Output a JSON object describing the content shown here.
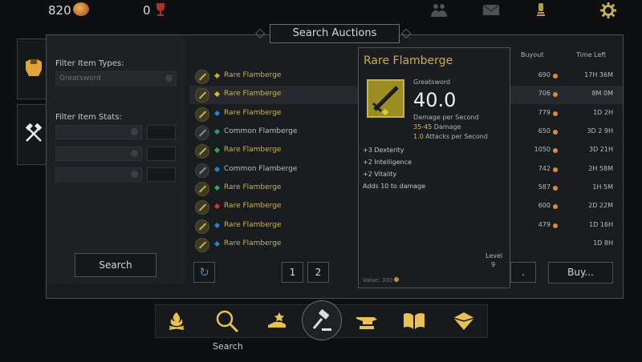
{
  "top_bar": {
    "gold": "820",
    "trophies": "0",
    "icons": [
      "coin-icon",
      "trophy-icon",
      "guild-icon",
      "mail-icon",
      "quest-icon",
      "gear-icon"
    ]
  },
  "side_tabs": [
    "armor-icon",
    "crafting-hammer-icon"
  ],
  "title": "Search Auctions",
  "filters": {
    "item_types_label": "Filter Item Types:",
    "item_type_value": "Greatsword",
    "item_stats_label": "Filter Item Stats:",
    "search_button": "Search"
  },
  "columns": {
    "buyout": "Buyout",
    "time_left": "Time Left"
  },
  "listings": [
    {
      "name": "Rare Flamberge",
      "buyout": "690",
      "time_left": "17H 36M",
      "gem": "#d4a42c",
      "rarity_color": "#c9b15a"
    },
    {
      "name": "Rare Flamberge",
      "buyout": "706",
      "time_left": "8M 0M",
      "gem": "#d4c02c",
      "rarity_color": "#c9b15a"
    },
    {
      "name": "Rare Flamberge",
      "buyout": "779",
      "time_left": "1D 2H",
      "gem": "#2d7fd0",
      "rarity_color": "#c9b15a"
    },
    {
      "name": "Common Flamberge",
      "buyout": "650",
      "time_left": "3D 2 9H",
      "gem": "#2c9a6a",
      "rarity_color": "#b9bcc0"
    },
    {
      "name": "Rare Flamberge",
      "buyout": "1050",
      "time_left": "3D 21H",
      "gem": "#3aa34d",
      "rarity_color": "#c9b15a"
    },
    {
      "name": "Common Flamberge",
      "buyout": "742",
      "time_left": "2H 58M",
      "gem": "#2d7fd0",
      "rarity_color": "#b9bcc0"
    },
    {
      "name": "Rare Flamberge",
      "buyout": "587",
      "time_left": "1H 5M",
      "gem": "#3aa34d",
      "rarity_color": "#c9b15a"
    },
    {
      "name": "Rare Flamberge",
      "buyout": "600",
      "time_left": "2D 22M",
      "gem": "#c8402f",
      "rarity_color": "#c9b15a"
    },
    {
      "name": "Rare Flamberge",
      "buyout": "479",
      "time_left": "1D 16H",
      "gem": "#2d7fd0",
      "rarity_color": "#c9b15a"
    },
    {
      "name": "Rare Flamberge",
      "buyout": "",
      "time_left": "1D 8H",
      "gem": "#2d7fd0",
      "rarity_color": "#c9b15a"
    }
  ],
  "pagination": {
    "refresh_icon": "refresh-icon",
    "pages": [
      "1",
      "2"
    ]
  },
  "buy_button": "Buy...",
  "tooltip": {
    "name": "Rare Flamberge",
    "type": "Greatsword",
    "dps": "40.0",
    "dps_label": "Damage per Second",
    "damage": "35-45",
    "damage_label": "Damage",
    "attacks": "1.0",
    "attacks_label": "Attacks per Second",
    "stats": [
      "+3 Dexterity",
      "+2 Intelligence",
      "+2 Vitality",
      "Adds 10 to damage"
    ],
    "level_label": "Level",
    "level": "9",
    "value_label": "Value:",
    "value": "330"
  },
  "bottom_nav": {
    "items": [
      "campfire-icon",
      "search-icon",
      "trade-icon",
      "auction-gavel-icon",
      "anvil-icon",
      "book-icon",
      "map-icon"
    ],
    "search_label": "Search"
  }
}
